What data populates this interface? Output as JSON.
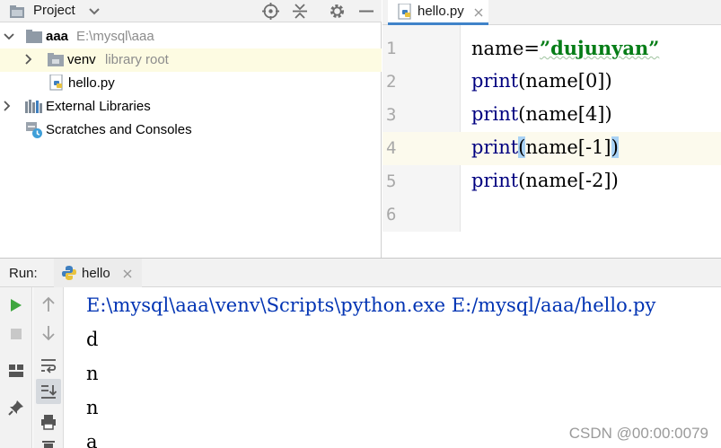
{
  "project_panel": {
    "title": "Project",
    "tree": [
      {
        "name": "aaa",
        "path": "E:\\mysql\\aaa"
      },
      {
        "name": "venv",
        "hint": "library root"
      },
      {
        "name": "hello.py"
      },
      {
        "name": "External Libraries"
      },
      {
        "name": "Scratches and Consoles"
      }
    ]
  },
  "editor": {
    "tab_label": "hello.py",
    "lines": [
      {
        "number": "1",
        "segments": [
          "name=",
          "”dujunyan”"
        ]
      },
      {
        "number": "2",
        "segments": [
          "print",
          "(name[0])"
        ]
      },
      {
        "number": "3",
        "segments": [
          "print",
          "(name[4])"
        ]
      },
      {
        "number": "4",
        "segments": [
          "print",
          "(",
          "name[-1]",
          ")"
        ]
      },
      {
        "number": "5",
        "segments": [
          "print",
          "(name[-2])"
        ]
      },
      {
        "number": "6",
        "segments": []
      }
    ],
    "current_line": 4
  },
  "run_panel": {
    "label": "Run:",
    "tab_label": "hello",
    "console": [
      "E:\\mysql\\aaa\\venv\\Scripts\\python.exe E:/mysql/aaa/hello.py",
      "d",
      "n",
      "n",
      "a"
    ]
  },
  "watermark": "CSDN @00:00:0079",
  "colors": {
    "keyword": "#000080",
    "string": "#067d17",
    "console_command": "#0033b3",
    "tab_underline": "#4083c9",
    "selection_row": "#fdfbe2",
    "brace_highlight": "#a9d2f5",
    "run_green": "#3ea63e"
  }
}
